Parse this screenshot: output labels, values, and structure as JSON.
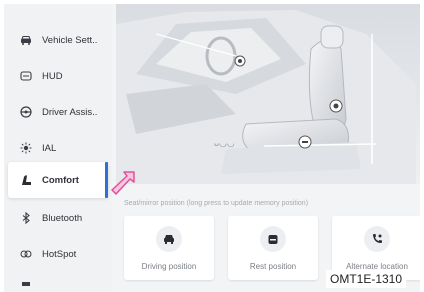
{
  "sidebar": {
    "items": [
      {
        "label": "Vehicle Sett..",
        "icon": "car-icon"
      },
      {
        "label": "HUD",
        "icon": "hud-icon"
      },
      {
        "label": "Driver Assis..",
        "icon": "steering-wheel-icon"
      },
      {
        "label": "IAL",
        "icon": "light-icon"
      },
      {
        "label": "Comfort",
        "icon": "seat-icon",
        "active": true
      },
      {
        "label": "Bluetooth",
        "icon": "bluetooth-icon"
      },
      {
        "label": "HotSpot",
        "icon": "hotspot-icon"
      }
    ]
  },
  "main": {
    "caption": "Seat/mirror position (long press to update memory position)",
    "positions": [
      {
        "label": "Driving position",
        "icon": "car-front-icon"
      },
      {
        "label": "Rest position",
        "icon": "seat-rest-icon"
      },
      {
        "label": "Alternate location",
        "icon": "phone-location-icon"
      }
    ]
  },
  "watermark": "OMT1E-1310",
  "colors": {
    "accent": "#2f6fd6",
    "pointer": "#e0529a",
    "background": "#f3f4f6"
  }
}
